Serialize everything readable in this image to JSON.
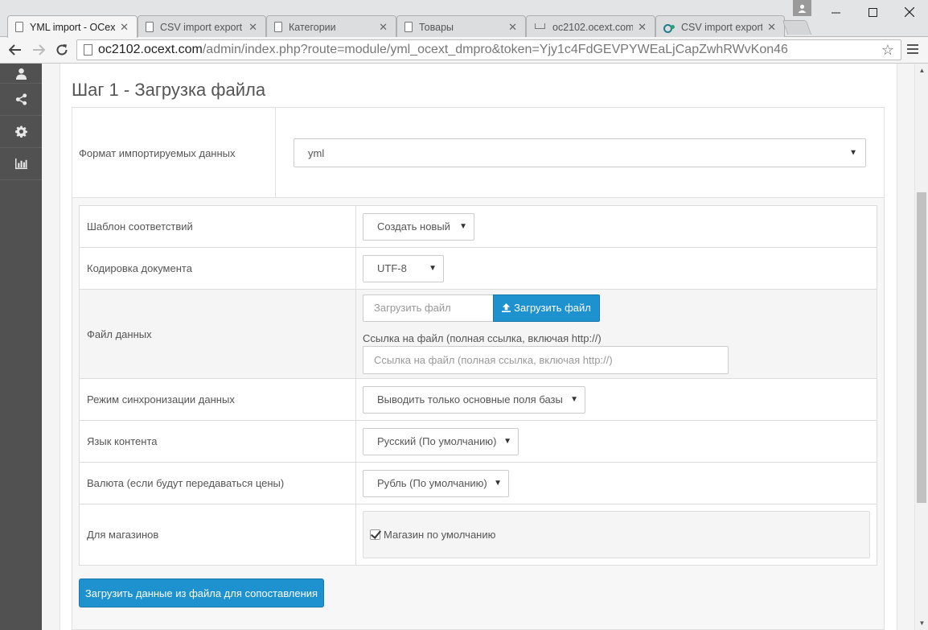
{
  "browser": {
    "tabs": [
      {
        "title": "YML import - OCext",
        "active": true,
        "icon": "page-icon"
      },
      {
        "title": "CSV import export",
        "active": false,
        "icon": "page-icon"
      },
      {
        "title": "Категории",
        "active": false,
        "icon": "page-icon"
      },
      {
        "title": "Товары",
        "active": false,
        "icon": "page-icon"
      },
      {
        "title": "oc2102.ocext.com/",
        "active": false,
        "icon": "cart-icon"
      },
      {
        "title": "CSV import export",
        "active": false,
        "icon": "ocext-icon"
      }
    ],
    "tab_close": "✕",
    "url_host": "oc2102.ocext.com",
    "url_path": "/admin/index.php?route=module/yml_ocext_dmpro&token=Yjy1c4FdGEVPYWEaLjCapZwhRWvKon46",
    "window_controls": {
      "minimize": "—",
      "maximize": "☐",
      "close": "✕"
    }
  },
  "sidebar": {
    "items": [
      {
        "name": "user-icon"
      },
      {
        "name": "share-icon"
      },
      {
        "name": "gear-icon"
      },
      {
        "name": "bar-chart-icon"
      }
    ]
  },
  "page": {
    "step_title": "Шаг 1 - Загрузка файла",
    "format": {
      "label": "Формат импортируемых данных",
      "value": "yml"
    },
    "rows": {
      "template": {
        "label": "Шаблон соответствий",
        "value": "Создать новый"
      },
      "encoding": {
        "label": "Кодировка документа",
        "value": "UTF-8"
      },
      "file": {
        "label": "Файл данных",
        "upload_placeholder": "Загрузить файл",
        "upload_button": "Загрузить файл",
        "url_help": "Ссылка на файл (полная ссылка, включая http://)",
        "url_placeholder": "Ссылка на файл (полная ссылка, включая http://)"
      },
      "sync_mode": {
        "label": "Режим синхронизации данных",
        "value": "Выводить только основные поля базы"
      },
      "language": {
        "label": "Язык контента",
        "value": "Русский (По умолчанию)"
      },
      "currency": {
        "label": "Валюта (если будут передаваться цены)",
        "value": "Рубль (По умолчанию)"
      },
      "stores": {
        "label": "Для магазинов",
        "store": "Магазин по умолчанию",
        "checked": true
      }
    },
    "submit_button": "Загрузить данные из файла для сопоставления"
  },
  "colors": {
    "primary_button": "#1e91cf",
    "sidebar_bg": "#515151"
  }
}
